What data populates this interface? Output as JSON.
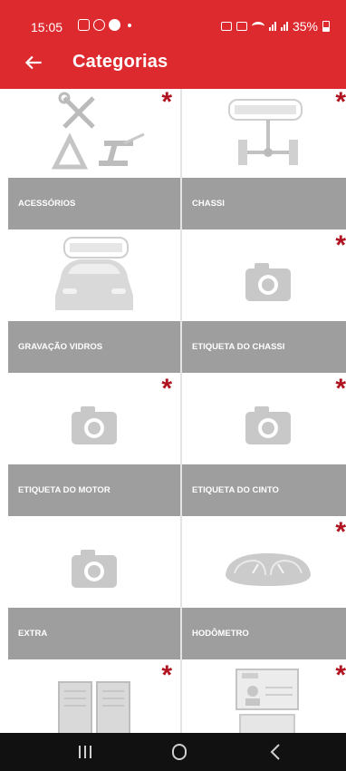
{
  "status": {
    "time": "15:05",
    "battery": "35%"
  },
  "header": {
    "title": "Categorias"
  },
  "categories": [
    {
      "label": "ACESSÓRIOS",
      "required": true,
      "icon": "accessories-icon"
    },
    {
      "label": "CHASSI",
      "required": true,
      "icon": "chassis-icon"
    },
    {
      "label": "GRAVAÇÃO VIDROS",
      "required": false,
      "icon": "car-windows-icon"
    },
    {
      "label": "ETIQUETA DO CHASSI",
      "required": true,
      "icon": "camera-icon"
    },
    {
      "label": "ETIQUETA DO MOTOR",
      "required": true,
      "icon": "camera-icon"
    },
    {
      "label": "ETIQUETA DO CINTO",
      "required": true,
      "icon": "camera-icon"
    },
    {
      "label": "EXTRA",
      "required": false,
      "icon": "camera-icon"
    },
    {
      "label": "HODÔMETRO",
      "required": true,
      "icon": "odometer-icon"
    },
    {
      "label": "",
      "required": true,
      "icon": "document-icon"
    },
    {
      "label": "",
      "required": true,
      "icon": "license-card-icon"
    }
  ],
  "required_marker": "*",
  "colors": {
    "primary": "#dc2a2f",
    "label_bg": "#9e9e9e",
    "required": "#b1121f"
  }
}
